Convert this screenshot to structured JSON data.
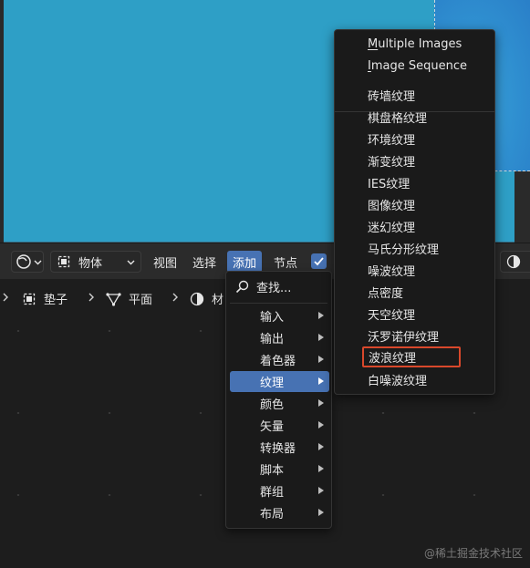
{
  "header": {
    "object_mode_label": "物体",
    "menus": [
      "视图",
      "选择",
      "添加",
      "节点"
    ]
  },
  "breadcrumb": {
    "items": [
      "垫子",
      "平面",
      "材"
    ]
  },
  "add_menu": {
    "search_label": "查找...",
    "items": [
      "输入",
      "输出",
      "着色器",
      "纹理",
      "颜色",
      "矢量",
      "转换器",
      "脚本",
      "群组",
      "布局"
    ]
  },
  "texture_submenu": {
    "top_items": [
      "Multiple Images",
      "Image Sequence"
    ],
    "items": [
      "砖墙纹理",
      "棋盘格纹理",
      "环境纹理",
      "渐变纹理",
      "IES纹理",
      "图像纹理",
      "迷幻纹理",
      "马氏分形纹理",
      "噪波纹理",
      "点密度",
      "天空纹理",
      "沃罗诺伊纹理",
      "波浪纹理",
      "白噪波纹理"
    ],
    "highlighted": "波浪纹理"
  },
  "watermark": "@稀土掘金技术社区",
  "colors": {
    "accent": "#4772b3",
    "highlight_box": "#d9482b",
    "viewport": "#2e9fc6"
  }
}
